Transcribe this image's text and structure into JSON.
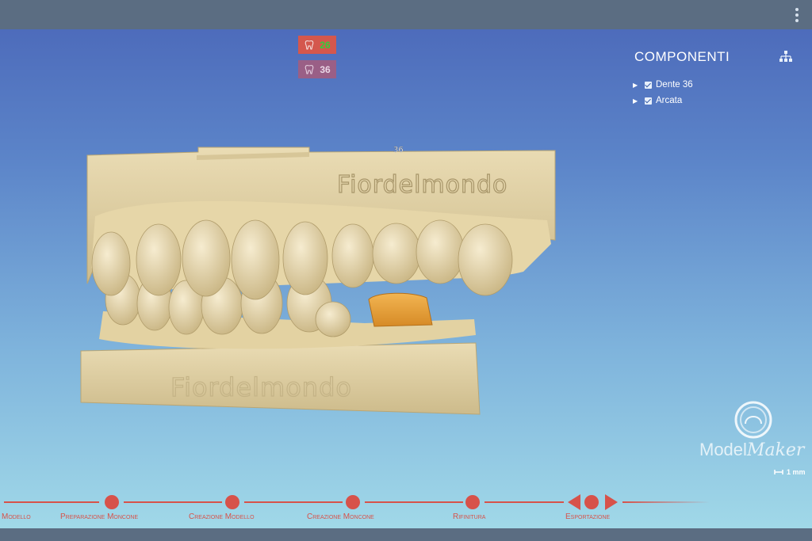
{
  "teeth": [
    {
      "label": "26",
      "label_color": "#2fd13a",
      "bg": "#d4574d",
      "state": "active"
    },
    {
      "label": "36",
      "label_color": "#ead7e6",
      "bg": "#9a5f86",
      "state": "inactive"
    }
  ],
  "components": {
    "title": "COMPONENTI",
    "items": [
      {
        "label": "Dente 36",
        "checked": true
      },
      {
        "label": "Arcata",
        "checked": true
      }
    ]
  },
  "model": {
    "engraving_top": "Fiordelmondo",
    "engraving_bottom": "Fiordelmondo",
    "tooth_tag": "36"
  },
  "logo": {
    "part1": "Model",
    "part2": "Maker"
  },
  "scale_label": "1 mm",
  "workflow": {
    "steps": [
      "Modello",
      "Preparazione Moncone",
      "Creazione Modello",
      "Creazione Moncone",
      "Rifinitura",
      "Esportazione"
    ],
    "color": "#d7524a"
  }
}
